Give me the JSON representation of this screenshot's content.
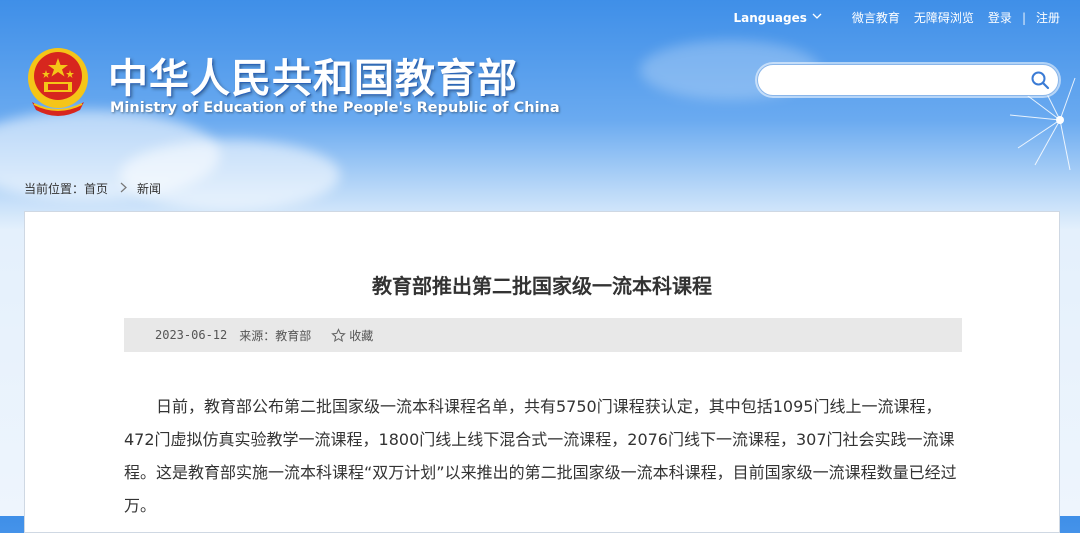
{
  "topbar": {
    "languages": "Languages",
    "links": [
      "微言教育",
      "无障碍浏览",
      "登录",
      "注册"
    ],
    "separator": "|"
  },
  "header": {
    "title_cn": "中华人民共和国教育部",
    "title_en": "Ministry of Education of the People's Republic of China"
  },
  "search": {
    "placeholder": "",
    "value": ""
  },
  "breadcrumb": {
    "label": "当前位置：",
    "items": [
      "首页",
      "新闻"
    ]
  },
  "article": {
    "title": "教育部推出第二批国家级一流本科课程",
    "date": "2023-06-12",
    "source": "来源：教育部",
    "favorite_label": "收藏",
    "body": "日前，教育部公布第二批国家级一流本科课程名单，共有5750门课程获认定，其中包括1095门线上一流课程，472门虚拟仿真实验教学一流课程，1800门线上线下混合式一流课程，2076门线下一流课程，307门社会实践一流课程。这是教育部实施一流本科课程“双万计划”以来推出的第二批国家级一流本科课程，目前国家级一流课程数量已经过万。"
  },
  "colors": {
    "sky_top": "#3f8fe8",
    "emblem_red": "#d7261e",
    "emblem_gold": "#f5c518",
    "meta_bg": "#e8e8e8"
  },
  "icons": [
    "chevron-down-icon",
    "search-icon",
    "national-emblem-icon",
    "chevron-right-icon",
    "star-outline-icon"
  ]
}
